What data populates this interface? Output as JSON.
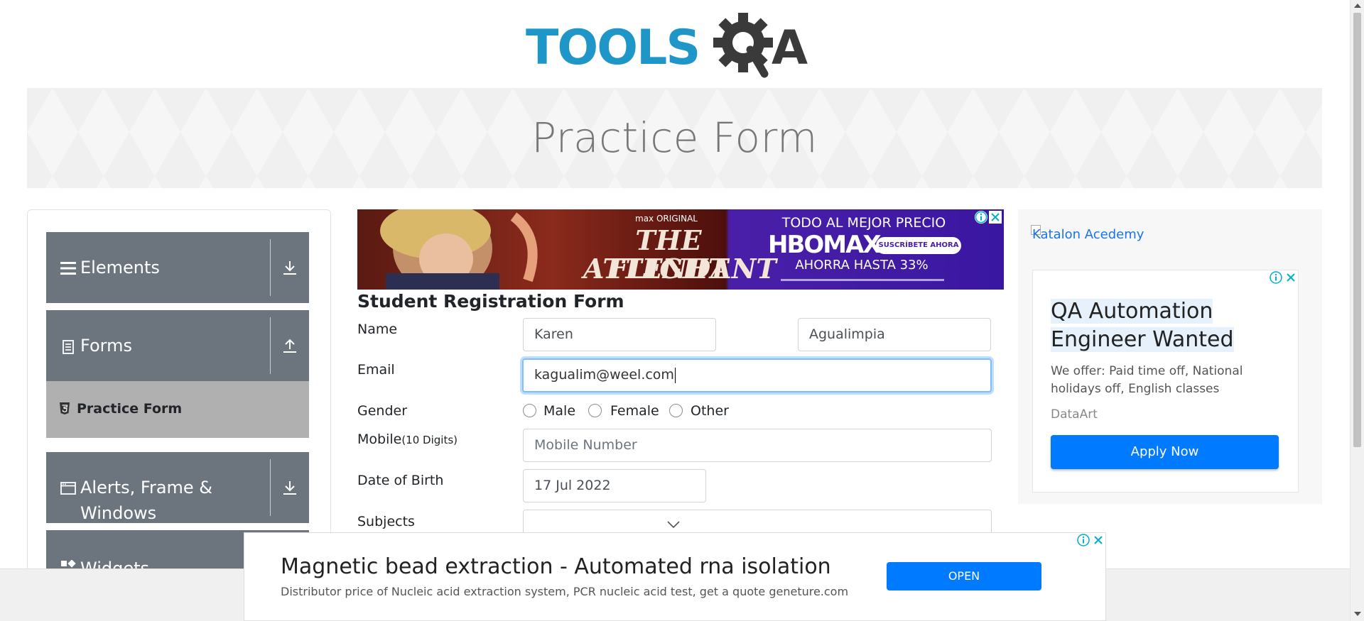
{
  "logo": {
    "text_left": "TOOLS",
    "text_right": "A"
  },
  "banner": {
    "title": "Practice Form"
  },
  "sidebar": {
    "groups": [
      {
        "label": "Elements"
      },
      {
        "label": "Forms"
      },
      {
        "label": "Alerts, Frame &",
        "label2": "Windows"
      },
      {
        "label": "Widgets"
      }
    ],
    "active_item": "Practice Form"
  },
  "top_ad": {
    "left_kicker": "max ORIGINAL",
    "left_title1": "THE FLIGHT",
    "left_title2": "ATTENDANT",
    "right_headline": "TODO AL MEJOR PRECIO",
    "right_brand": "HBOMAX",
    "right_button": "SUSCRÍBETE AHORA",
    "right_offer": "AHORRA HASTA 33%"
  },
  "form": {
    "title": "Student Registration Form",
    "name_label": "Name",
    "first_name": "Karen",
    "last_name": "Agualimpia",
    "email_label": "Email",
    "email_value": "kagualim@weel.com",
    "gender_label": "Gender",
    "gender_options": [
      "Male",
      "Female",
      "Other"
    ],
    "mobile_label": "Mobile",
    "mobile_hint": "(10 Digits)",
    "mobile_placeholder": "Mobile Number",
    "dob_label": "Date of Birth",
    "dob_value": "17 Jul 2022",
    "subjects_label": "Subjects"
  },
  "side_ad": {
    "image_alt": "Katalon Acedemy",
    "headline": "QA Automation Engineer Wanted",
    "body": "We offer: Paid time off, National holidays off, English classes",
    "company": "DataArt",
    "cta": "Apply Now"
  },
  "bottom_ad": {
    "headline": "Magnetic bead extraction - Automated rna isolation",
    "body": "Distributor price of Nucleic acid extraction system, PCR nucleic acid test, get a quote geneture.com",
    "cta": "OPEN"
  },
  "colors": {
    "logo_blue": "#1e96c8",
    "logo_dark": "#3a3a3a",
    "sidebar_group": "#6c757d",
    "sidebar_active": "#b0b0b0",
    "primary": "#007bff",
    "link": "#1a73e8",
    "ad_info": "#00aecd"
  }
}
